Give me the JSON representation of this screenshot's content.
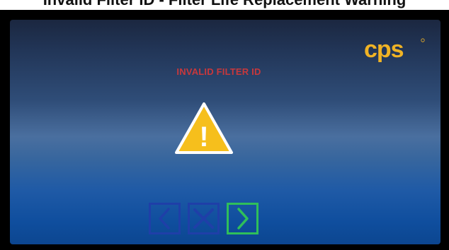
{
  "window": {
    "caption": "Invalid Filter ID - Filter Life Replacement Warning"
  },
  "screen": {
    "brand": "cps",
    "error_message": "INVALID FILTER ID",
    "warning_symbol": "!"
  },
  "icons": {
    "warning": "warning-triangle-icon",
    "back": "chevron-left-icon",
    "cancel": "x-icon",
    "next": "chevron-right-icon"
  },
  "colors": {
    "brand": "#f0b325",
    "error_text": "#c8383c",
    "warning_fill": "#f6bf1c",
    "nav_blue": "#1f3fa8",
    "nav_green": "#2fbf5a"
  }
}
